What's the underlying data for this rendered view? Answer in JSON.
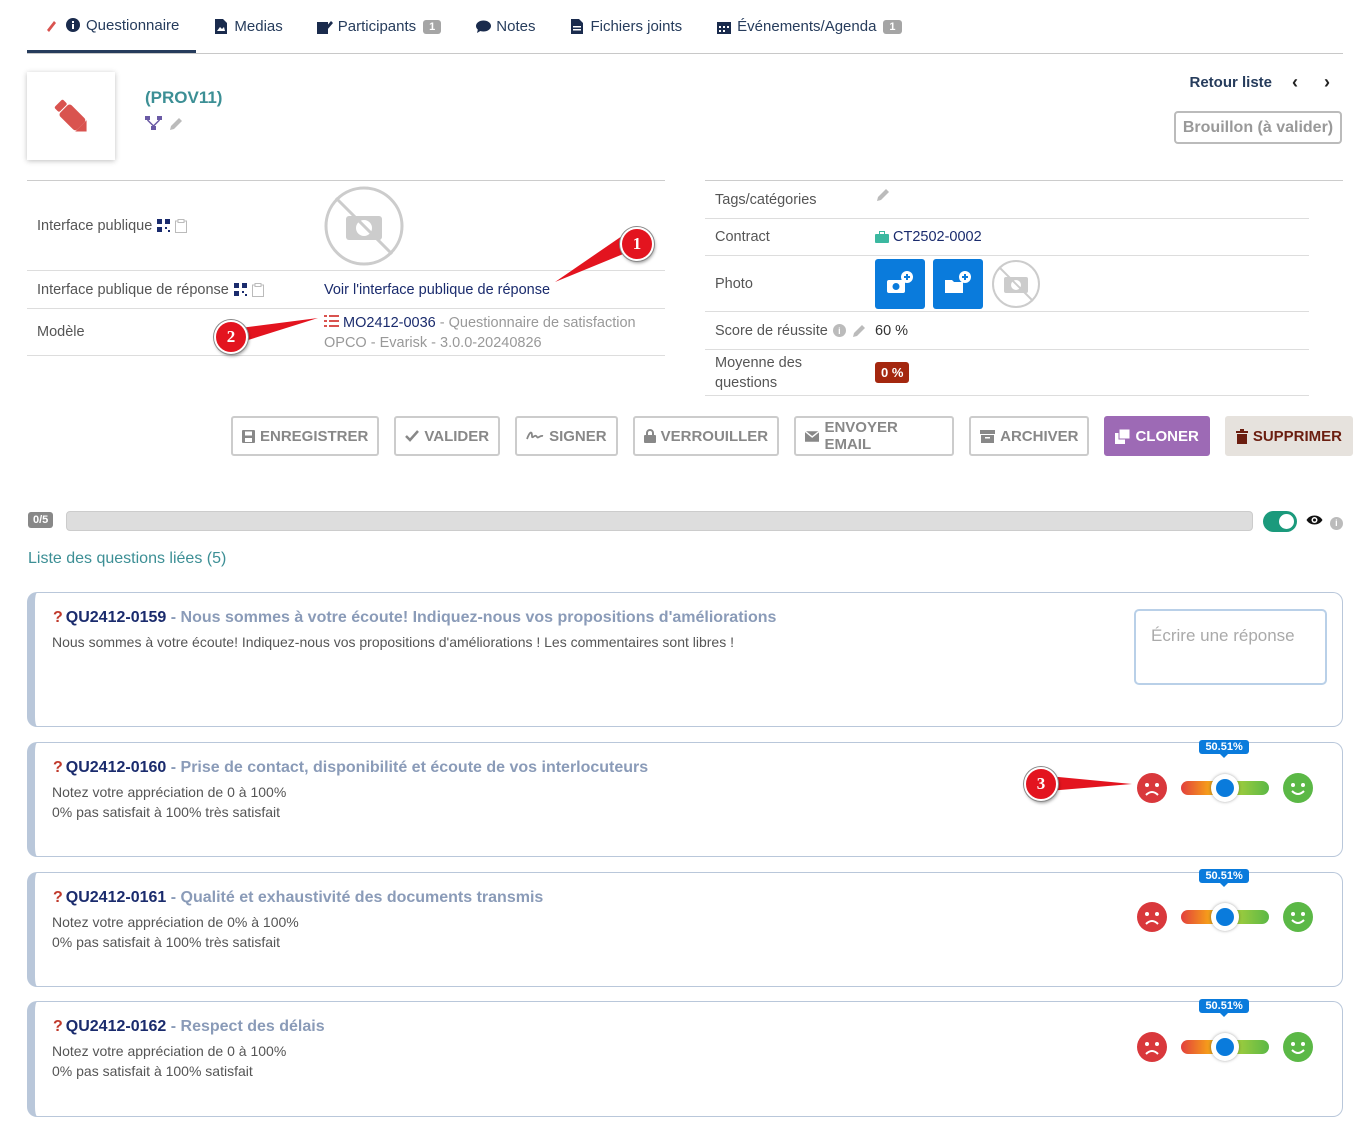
{
  "tabs": [
    {
      "label": "Questionnaire",
      "icon": "info-circle-icon",
      "active": true
    },
    {
      "label": "Medias",
      "icon": "file-image-icon"
    },
    {
      "label": "Participants",
      "icon": "user-edit-icon",
      "badge": "1"
    },
    {
      "label": "Notes",
      "icon": "comment-icon"
    },
    {
      "label": "Fichiers joints",
      "icon": "file-icon"
    },
    {
      "label": "Événements/Agenda",
      "icon": "calendar-icon",
      "badge": "1"
    }
  ],
  "header": {
    "ref": "(PROV11)",
    "back_label": "Retour liste",
    "status": "Brouillon (à valider)"
  },
  "left_fields": {
    "public_interface_label": "Interface publique",
    "public_response_label": "Interface publique de réponse",
    "public_response_link": "Voir l'interface publique de réponse",
    "model_label": "Modèle",
    "model_code": "MO2412-0036",
    "model_desc": " - Questionnaire de satisfaction OPCO - Evarisk - 3.0.0-20240826"
  },
  "right_fields": {
    "tags_label": "Tags/catégories",
    "contract_label": "Contract",
    "contract_value": "CT2502-0002",
    "photo_label": "Photo",
    "score_label": "Score de réussite",
    "score_value": "60 %",
    "avg_label": "Moyenne des questions",
    "avg_value": "0 %"
  },
  "actions": {
    "save": "ENREGISTRER",
    "validate": "VALIDER",
    "sign": "SIGNER",
    "lock": "VERROUILLER",
    "email": "ENVOYER EMAIL",
    "archive": "ARCHIVER",
    "clone": "CLONER",
    "delete": "SUPPRIMER"
  },
  "progress": {
    "label": "0/5",
    "value": 0
  },
  "list_title": "Liste des questions liées (5)",
  "questions": [
    {
      "code": "QU2412-0159",
      "title": " - Nous sommes à votre écoute! Indiquez-nous vos propositions d'améliorations",
      "desc1": "Nous sommes à votre écoute! Indiquez-nous vos propositions d'améliorations ! Les commentaires sont libres !",
      "desc2": "",
      "placeholder": "Écrire une réponse"
    },
    {
      "code": "QU2412-0160",
      "title": " - Prise de contact, disponibilité et écoute de vos interlocuteurs",
      "desc1": "Notez votre appréciation de 0 à 100%",
      "desc2": "0% pas satisfait à 100% très satisfait",
      "rating_label": "50.51%",
      "rating_value": 50.51
    },
    {
      "code": "QU2412-0161",
      "title": " - Qualité et exhaustivité des documents transmis",
      "desc1": "Notez votre appréciation de 0% à 100%",
      "desc2": "0% pas satisfait à 100% très satisfait",
      "rating_label": "50.51%",
      "rating_value": 50.51
    },
    {
      "code": "QU2412-0162",
      "title": " - Respect des délais",
      "desc1": "Notez votre appréciation de 0 à 100%",
      "desc2": "0% pas satisfait à 100% satisfait",
      "rating_label": "50.51%",
      "rating_value": 50.51
    }
  ],
  "annotations": [
    "1",
    "2",
    "3"
  ],
  "colors": {
    "navy": "#263c5c",
    "teal": "#3c8f95",
    "blue": "#0a7bdc",
    "purple": "#9d6ab5",
    "red": "#e3141f"
  }
}
